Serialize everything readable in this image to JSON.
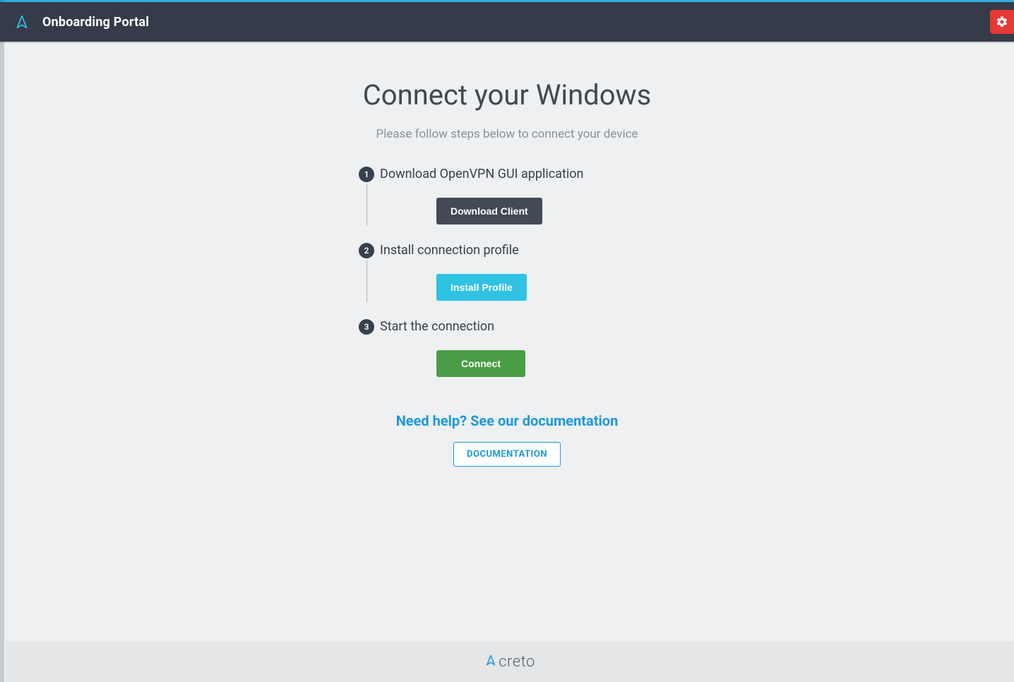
{
  "header": {
    "title": "Onboarding Portal"
  },
  "page": {
    "title": "Connect your Windows",
    "subtitle": "Please follow steps below to connect your device"
  },
  "steps": [
    {
      "num": "1",
      "label": "Download OpenVPN GUI application",
      "button": "Download Client",
      "btn_class": "btn-dark"
    },
    {
      "num": "2",
      "label": "Install connection profile",
      "button": "Install Profile",
      "btn_class": "btn-cyan"
    },
    {
      "num": "3",
      "label": "Start the connection",
      "button": "Connect",
      "btn_class": "btn-green"
    }
  ],
  "help": {
    "title": "Need help? See our documentation",
    "button": "DOCUMENTATION"
  },
  "footer": {
    "brand": "creto"
  }
}
